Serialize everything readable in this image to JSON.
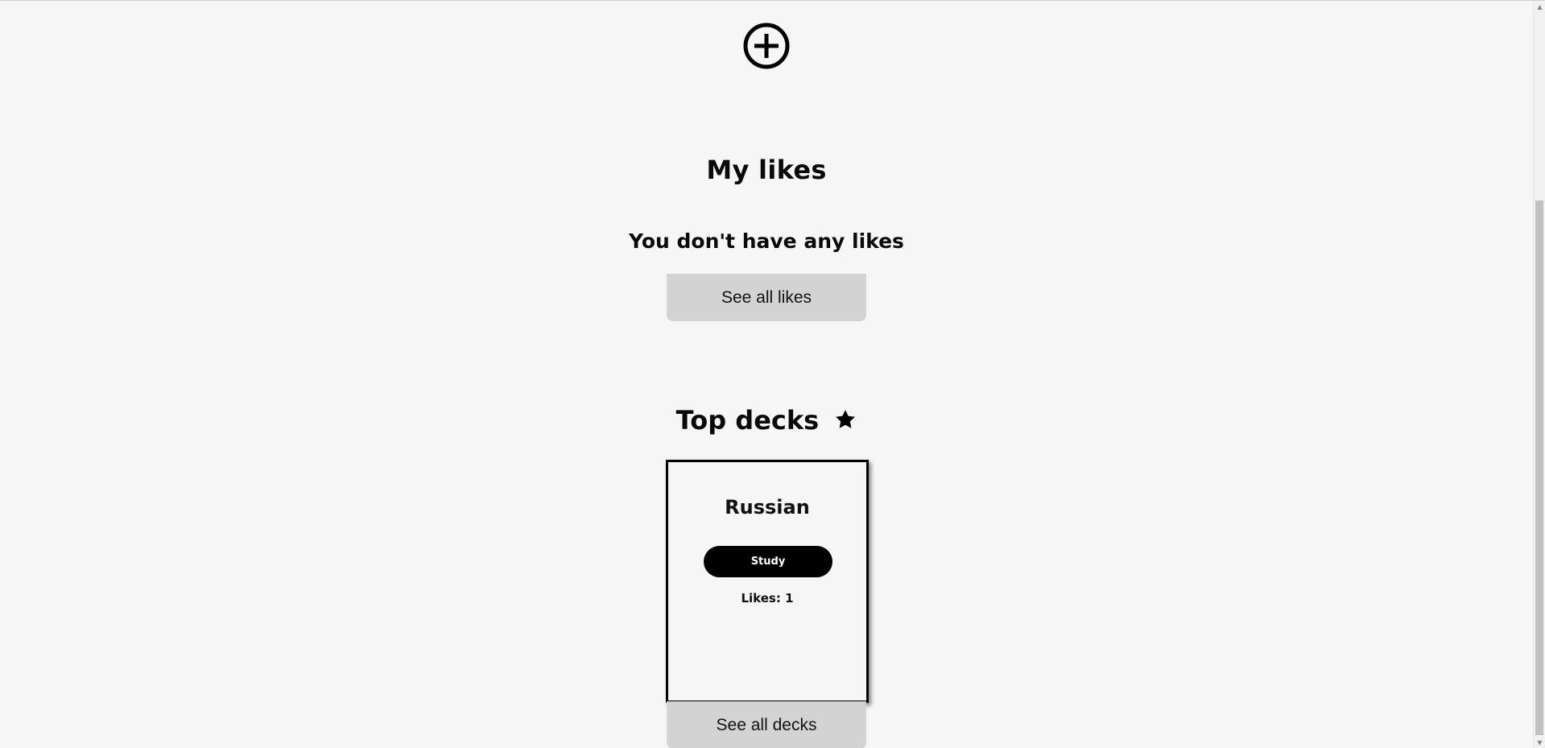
{
  "add_button": {
    "icon": "plus-circle-icon"
  },
  "likes_section": {
    "title": "My likes",
    "empty_message": "You don't have any likes",
    "see_all_label": "See all likes"
  },
  "top_decks_section": {
    "title": "Top decks",
    "title_icon": "star-icon",
    "decks": [
      {
        "name": "Russian",
        "study_label": "Study",
        "likes_label": "Likes: 1"
      }
    ],
    "see_all_label": "See all decks"
  },
  "colors": {
    "background": "#f6f6f6",
    "button_gray": "#d3d3d3",
    "primary": "#000000",
    "primary_text": "#ffffff"
  },
  "scrollbar": {
    "up_icon": "arrow-up-icon",
    "down_icon": "arrow-down-icon"
  }
}
